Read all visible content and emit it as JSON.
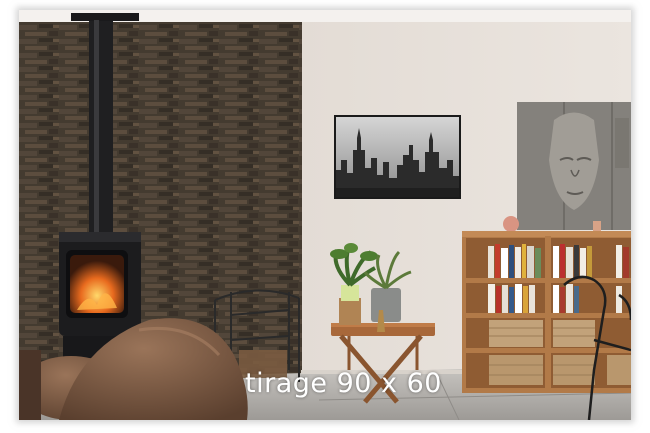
{
  "caption": {
    "text": "tirage 90 x 60"
  },
  "scene": {
    "subject": "living-room-interior",
    "elements": [
      "stone-wall",
      "wood-stove",
      "stovepipe",
      "framed-city-print",
      "buddha-relief-panel",
      "bookshelf",
      "wicker-baskets",
      "folding-side-table",
      "potted-plants",
      "leather-armchair",
      "log-basket"
    ]
  },
  "colors": {
    "wall": "#e7dfd8",
    "stone": "#4a4035",
    "stove": "#1c1c1e",
    "wood": "#b27a48",
    "leather": "#7b5a44",
    "floor": "#b9b6b2",
    "caption": "#ffffff"
  }
}
